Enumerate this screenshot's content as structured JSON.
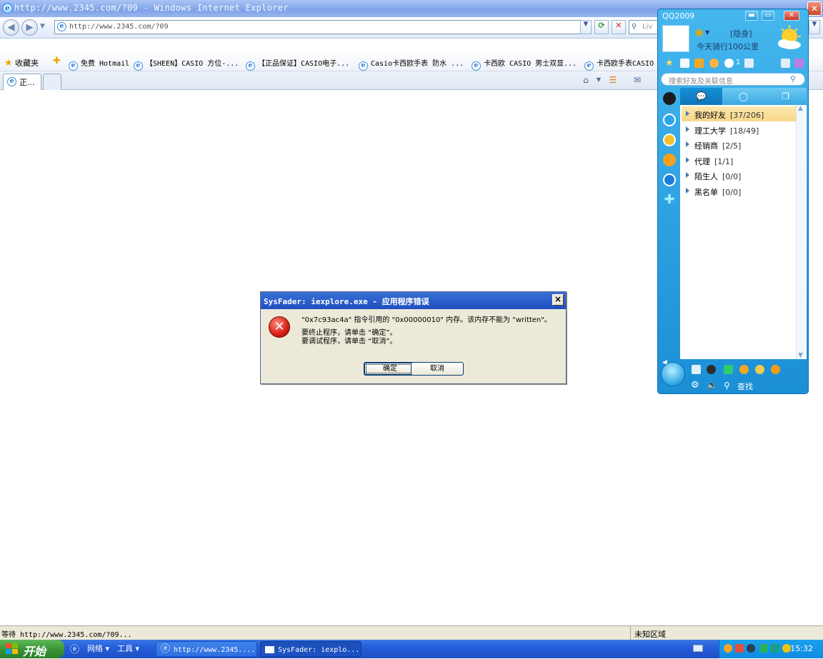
{
  "ie": {
    "title": "http://www.2345.com/?09 - Windows Internet Explorer",
    "address": "http://www.2345.com/?09",
    "search_placeholder": "Liv",
    "favorites_label": "收藏夹",
    "favorites": [
      {
        "label": "免费 Hotmail"
      },
      {
        "label": "【SHEEN】CASIO 方位-..."
      },
      {
        "label": "【正品保证】CASIO电子..."
      },
      {
        "label": "Casio卡西欧手表 防水 ..."
      },
      {
        "label": "卡西欧 CASIO 男士双显..."
      },
      {
        "label": "卡西欧手表CASIO"
      }
    ],
    "tab_label": "正...",
    "status_text": "等待 http://www.2345.com/?09...",
    "zone_text": "未知区域"
  },
  "dialog": {
    "title": "SysFader: iexplore.exe - 应用程序错误",
    "line1": "\"0x7c93ac4a\" 指令引用的 \"0x00000010\" 内存。该内存不能为 \"written\"。",
    "line2": "要终止程序，请单击 “确定”。",
    "line3": "要调试程序，请单击 “取消”。",
    "ok_label": "确定",
    "cancel_label": "取消"
  },
  "qq": {
    "title": "QQ2009",
    "status": "[隐身]",
    "signature": "今天骑行100公里",
    "search_placeholder": "搜索好友及关联信息",
    "mail_count": "1",
    "groups": [
      {
        "name": "我的好友",
        "count": "[37/206]"
      },
      {
        "name": "理工大学",
        "count": "[18/49]"
      },
      {
        "name": "经销商",
        "count": "[2/5]"
      },
      {
        "name": "代理",
        "count": "[1/1]"
      },
      {
        "name": "陌生人",
        "count": "[0/0]"
      },
      {
        "name": "黑名单",
        "count": "[0/0]"
      }
    ],
    "find_label": "查找"
  },
  "taskbar": {
    "start_label": "开始",
    "network_label": "网络",
    "tools_label": "工具",
    "tasks": [
      {
        "label": "http://www.2345...."
      },
      {
        "label": "SysFader: iexplo..."
      }
    ],
    "clock": "15:32"
  }
}
